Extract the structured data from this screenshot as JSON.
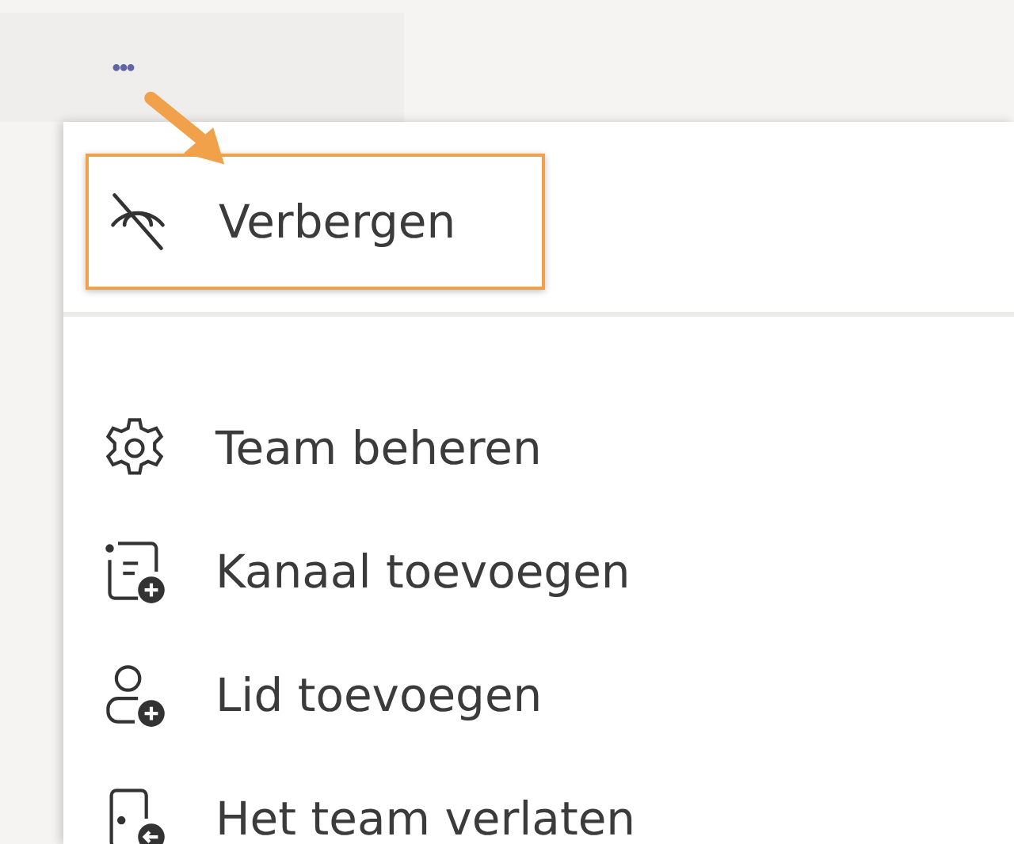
{
  "more_button": {
    "label": "•••"
  },
  "menu": {
    "sections": [
      {
        "items": [
          {
            "kind": "hide",
            "label": "Verbergen",
            "highlighted": true
          }
        ]
      },
      {
        "items": [
          {
            "kind": "settings",
            "label": "Team beheren",
            "highlighted": false
          },
          {
            "kind": "add-channel",
            "label": "Kanaal toevoegen",
            "highlighted": false
          },
          {
            "kind": "add-member",
            "label": "Lid toevoegen",
            "highlighted": false
          },
          {
            "kind": "leave",
            "label": "Het team verlaten",
            "highlighted": false
          }
        ]
      }
    ]
  }
}
